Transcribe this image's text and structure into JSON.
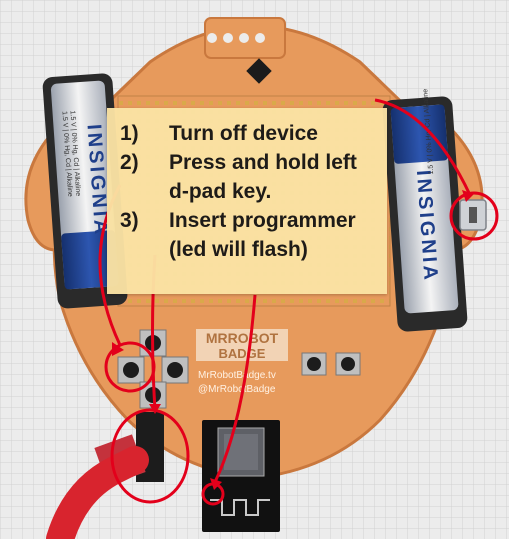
{
  "photo": {
    "board_logo_line1": "MRROBOT",
    "board_logo_line2": "BADGE",
    "board_url": "MrRobotBadge.tv",
    "board_handle": "@MrRobotBadge",
    "battery_brand": "INSIGNIA",
    "battery_spec_1": "1.5 V | 0% Hg, Cd | Alkaline",
    "battery_spec_2": "1.5 V | 0% Hg, Cd | Alkaline"
  },
  "instructions": {
    "steps": [
      {
        "number": "1)",
        "text": "Turn off device",
        "continuation": ""
      },
      {
        "number": "2)",
        "text": "Press and hold left",
        "continuation": "d-pad key."
      },
      {
        "number": "3)",
        "text": "Insert programmer",
        "continuation": "(led will flash)"
      }
    ]
  },
  "colors": {
    "background": "#e9e9e9",
    "grid": "#d2d2d2",
    "board": "#e79a5c",
    "board_edge": "#c9783e",
    "note": "#fbe3a4",
    "annotation": "#e3001b",
    "battery": "#1f3f8a",
    "cable": "#d8242e"
  }
}
